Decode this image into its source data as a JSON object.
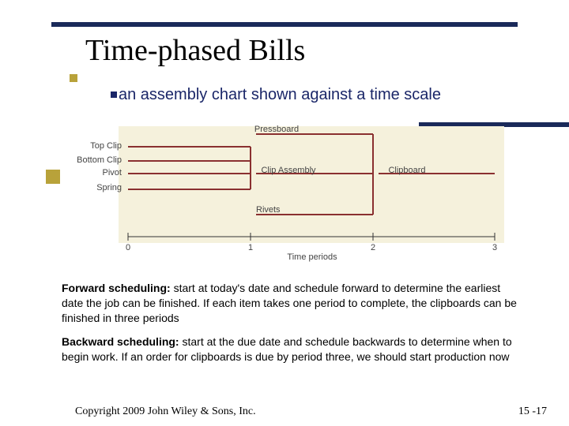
{
  "title": "Time-phased Bills",
  "bullet": "an assembly chart shown against a time scale",
  "chart_data": {
    "type": "bar",
    "title": "",
    "xlabel": "Time periods",
    "ylabel": "",
    "xlim": [
      0,
      3
    ],
    "ticks": [
      0,
      1,
      2,
      3
    ],
    "items": [
      {
        "name": "Pressboard",
        "start": 1.05,
        "end": 2.0,
        "y": 0
      },
      {
        "name": "Top Clip",
        "start": 0.0,
        "end": 1.0,
        "y": 1
      },
      {
        "name": "Bottom Clip",
        "start": 0.0,
        "end": 1.0,
        "y": 2
      },
      {
        "name": "Clip Assembly",
        "start": 1.05,
        "end": 2.0,
        "y": 3
      },
      {
        "name": "Pivot",
        "start": 0.0,
        "end": 1.0,
        "y": 4
      },
      {
        "name": "Spring",
        "start": 0.0,
        "end": 1.0,
        "y": 5
      },
      {
        "name": "Clipboard",
        "start": 2.05,
        "end": 3.0,
        "y": 6
      },
      {
        "name": "Rivets",
        "start": 1.05,
        "end": 2.0,
        "y": 7
      }
    ],
    "connectors": [
      {
        "x": 1.0,
        "from_y": 1,
        "to_y": 5
      },
      {
        "x": 2.0,
        "from_y": 0,
        "to_y": 7
      }
    ]
  },
  "labels": {
    "pressboard": "Pressboard",
    "topclip": "Top Clip",
    "bottomclip": "Bottom Clip",
    "clipassembly": "Clip Assembly",
    "pivot": "Pivot",
    "spring": "Spring",
    "clipboard": "Clipboard",
    "rivets": "Rivets",
    "timeperiods": "Time periods",
    "t0": "0",
    "t1": "1",
    "t2": "2",
    "t3": "3"
  },
  "para1_bold": "Forward scheduling:",
  "para1_rest": " start at today's date and schedule forward to determine the earliest date the job can be finished. If each item takes one period to complete, the clipboards can be finished in three periods",
  "para2_bold": "Backward scheduling:",
  "para2_rest": " start at the due date and schedule backwards to determine when to begin work. If an order for clipboards is due by period three, we should start production now",
  "copyright": "Copyright 2009 John Wiley & Sons, Inc.",
  "pagenum": "15 -17"
}
